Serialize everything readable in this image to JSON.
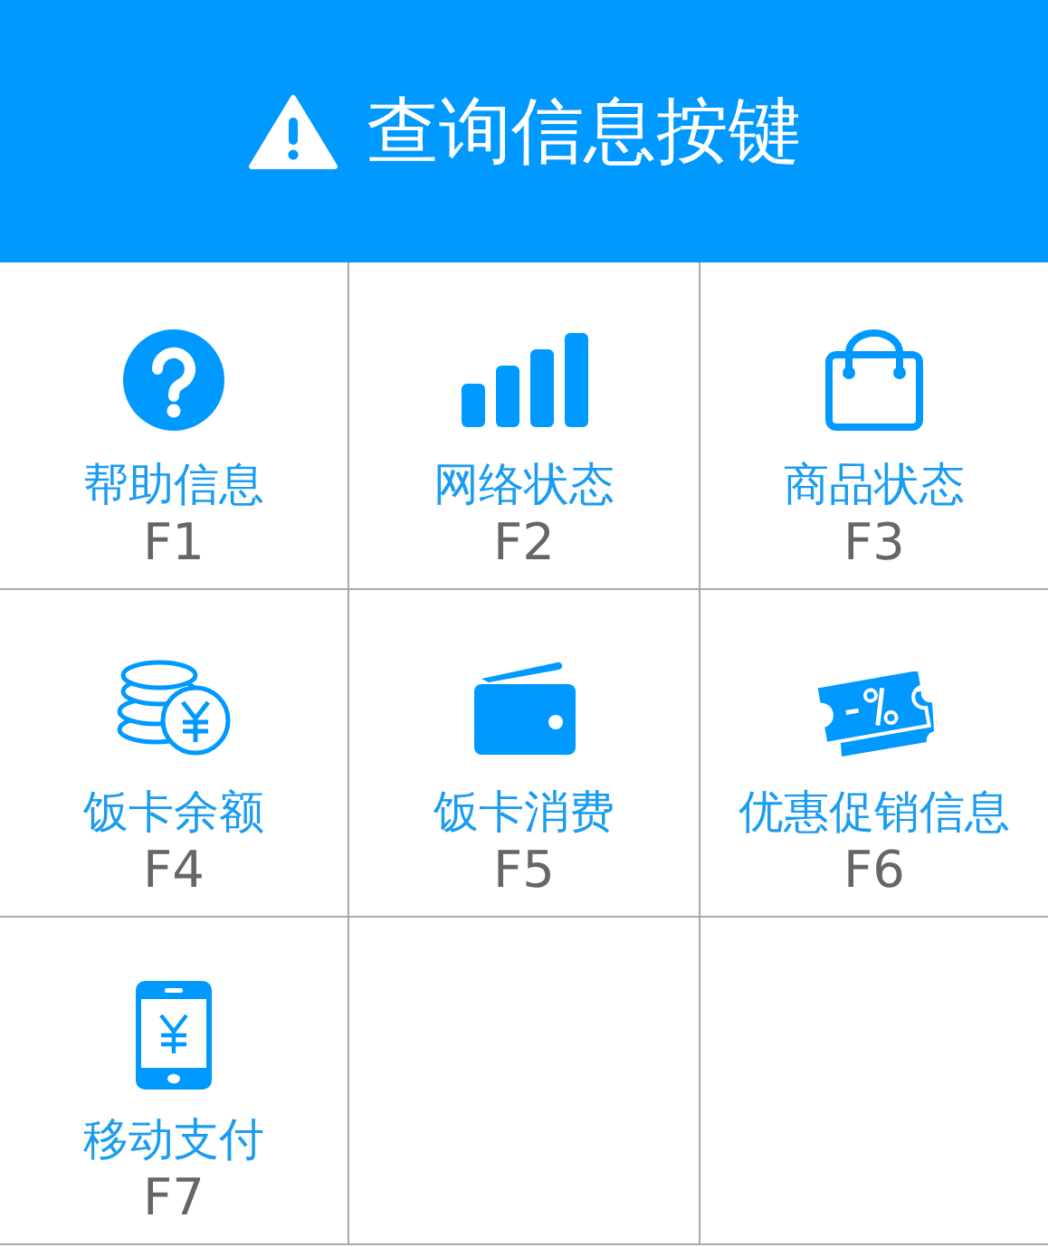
{
  "header": {
    "title": "查询信息按键"
  },
  "keys": [
    {
      "kind": "help",
      "label": "帮助信息",
      "key": "F1"
    },
    {
      "kind": "signal",
      "label": "网络状态",
      "key": "F2"
    },
    {
      "kind": "bag",
      "label": "商品状态",
      "key": "F3"
    },
    {
      "kind": "coins",
      "label": "饭卡余额",
      "key": "F4"
    },
    {
      "kind": "wallet",
      "label": "饭卡消费",
      "key": "F5"
    },
    {
      "kind": "coupon",
      "label": "优惠促销信息",
      "key": "F6"
    },
    {
      "kind": "phone",
      "label": "移动支付",
      "key": "F7"
    }
  ]
}
